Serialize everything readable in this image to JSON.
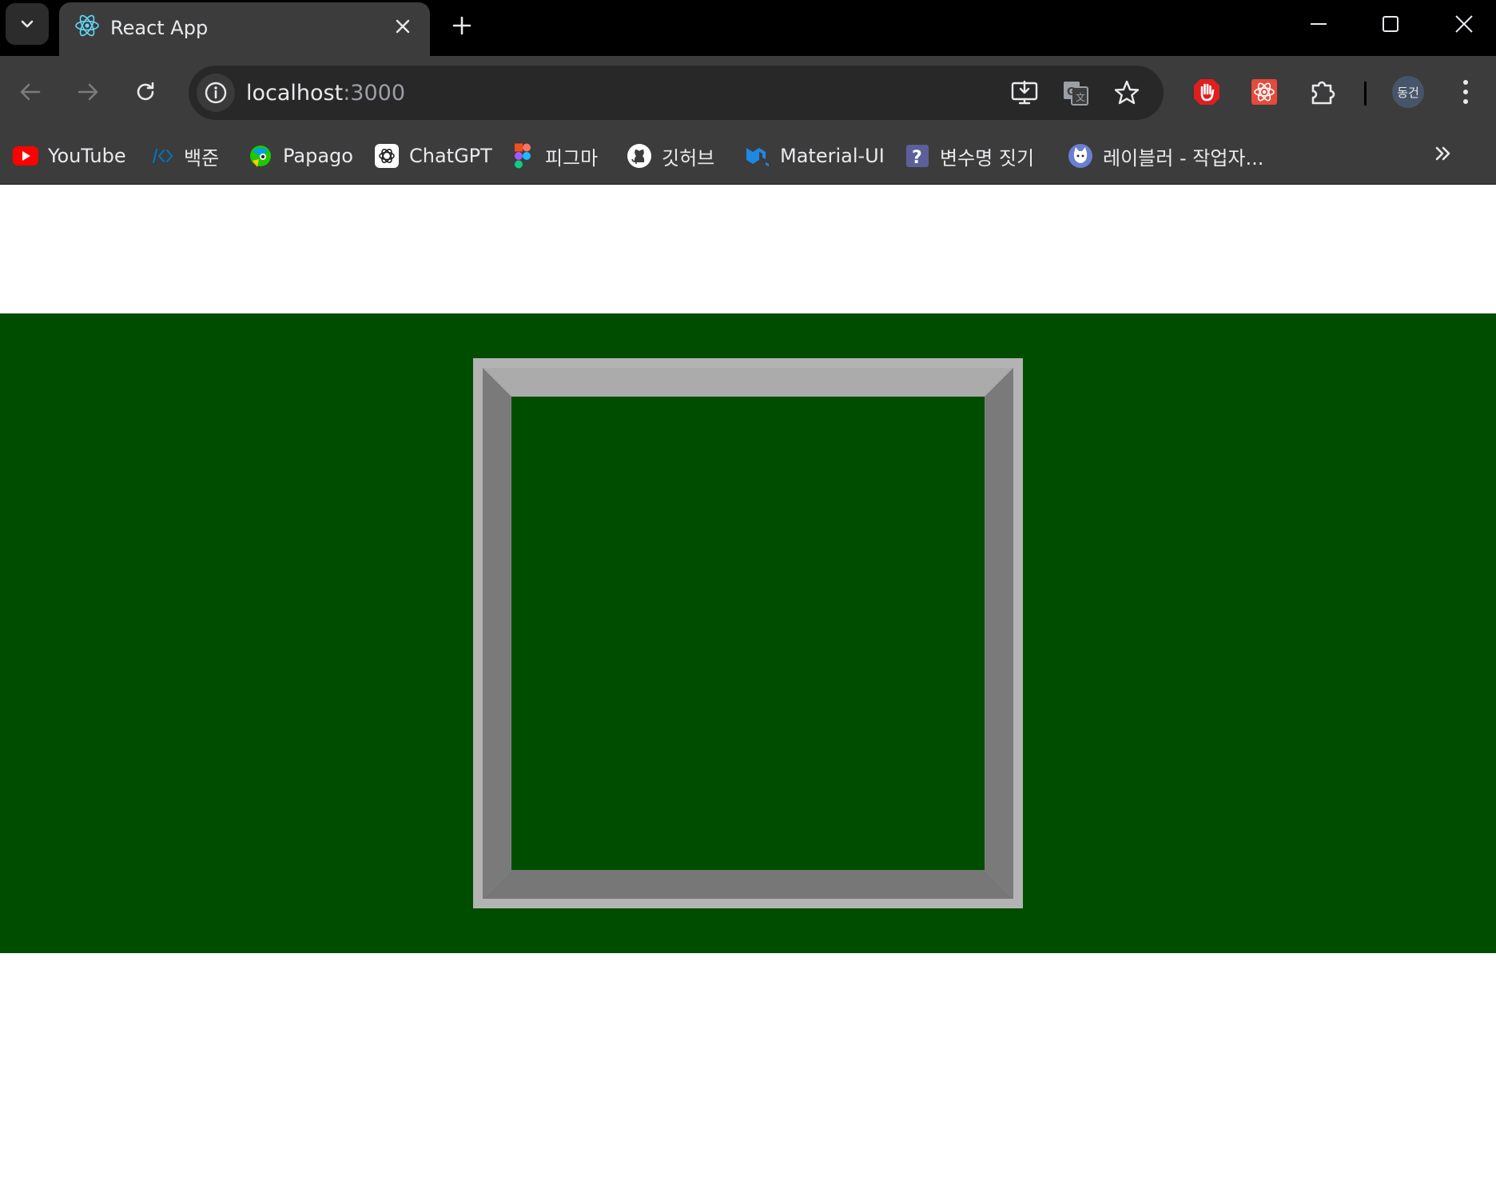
{
  "browser": {
    "tab": {
      "title": "React App"
    },
    "address_bar": {
      "host": "localhost",
      "port": ":3000"
    },
    "profile": {
      "initials": "동건"
    },
    "bookmarks": [
      {
        "label": "YouTube",
        "icon": "youtube-icon"
      },
      {
        "label": "백준",
        "icon": "code-brackets-icon"
      },
      {
        "label": "Papago",
        "icon": "papago-icon"
      },
      {
        "label": "ChatGPT",
        "icon": "chatgpt-icon"
      },
      {
        "label": "피그마",
        "icon": "figma-icon"
      },
      {
        "label": "깃허브",
        "icon": "github-icon"
      },
      {
        "label": "Material-UI",
        "icon": "mui-icon"
      },
      {
        "label": "변수명 짓기",
        "icon": "question-icon"
      },
      {
        "label": "레이블러 - 작업자...",
        "icon": "cat-icon"
      }
    ]
  },
  "page": {
    "band_color": "#004d00",
    "frame_colors": {
      "outer": "#b3b3b3",
      "top": "#ababab",
      "left": "#7a7a7a",
      "right": "#7a7a7a",
      "bottom": "#777777",
      "inner": "#004d00"
    }
  }
}
